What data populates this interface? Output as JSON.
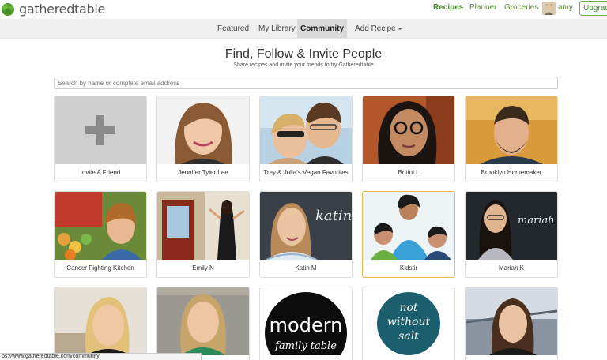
{
  "header": {
    "logo_text": "gatheredtable",
    "nav": [
      {
        "label": "Recipes",
        "active": true
      },
      {
        "label": "Planner",
        "active": false
      },
      {
        "label": "Groceries",
        "active": false
      }
    ],
    "user_name": "amy",
    "upgrade_label": "Upgrade"
  },
  "subnav": {
    "items": [
      {
        "label": "Featured",
        "active": false
      },
      {
        "label": "My Library",
        "active": false
      },
      {
        "label": "Community",
        "active": true
      },
      {
        "label": "Add Recipe",
        "active": false,
        "dropdown": true
      }
    ]
  },
  "main": {
    "title": "Find, Follow & Invite People",
    "subtitle": "Share recipes and invite your friends to try Gatheredtable",
    "search_placeholder": "Search by name or complete email address",
    "people": [
      {
        "name": "Invite A Friend"
      },
      {
        "name": "Jennifer Tyler Lee"
      },
      {
        "name": "Trey & Julia's Vegan Favorites"
      },
      {
        "name": "Brittni L"
      },
      {
        "name": "Brooklyn Homemaker"
      },
      {
        "name": "Cancer Fighting Kitchen"
      },
      {
        "name": "Emily N"
      },
      {
        "name": "Katin M"
      },
      {
        "name": "Kidstir"
      },
      {
        "name": "Mariah K"
      },
      {
        "name": ""
      },
      {
        "name": ""
      },
      {
        "name": "",
        "logo_lines": [
          "modern",
          "family table"
        ]
      },
      {
        "name": "",
        "logo_lines": [
          "not",
          "without",
          "salt"
        ]
      },
      {
        "name": ""
      }
    ],
    "photo_words": {
      "katin": "katin",
      "mariah": "mariah"
    }
  },
  "status_url": "ps://www.gatheredtable.com/community",
  "colors": {
    "accent": "#3f8a26",
    "featured_border": "#f0b74a"
  }
}
